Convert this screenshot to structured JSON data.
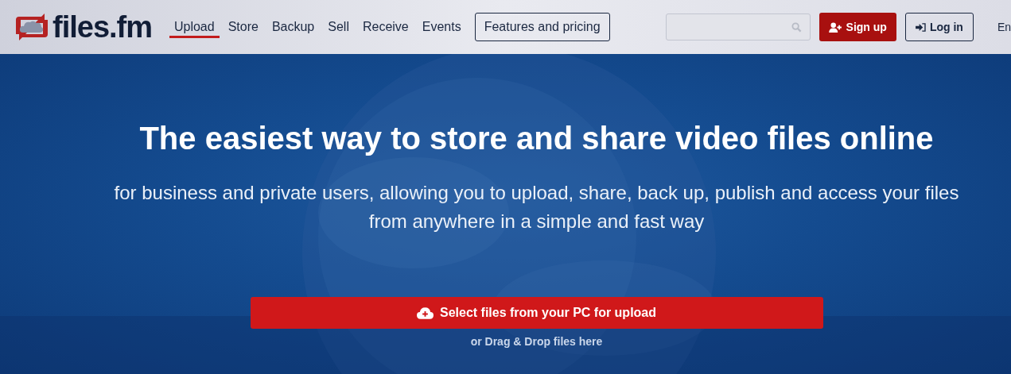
{
  "header": {
    "logo": "files.fm",
    "nav": [
      {
        "label": "Upload",
        "selected": true
      },
      {
        "label": "Store",
        "selected": false
      },
      {
        "label": "Backup",
        "selected": false
      },
      {
        "label": "Sell",
        "selected": false
      },
      {
        "label": "Receive",
        "selected": false
      },
      {
        "label": "Events",
        "selected": false
      }
    ],
    "features_button": "Features and pricing",
    "signup_button": "Sign up",
    "login_button": "Log in",
    "language": "En"
  },
  "hero": {
    "title": "The easiest way to store and share video files online",
    "subtitle": "for business and private users, allowing you to upload, share, back up, publish and access your files from anywhere in a simple and fast way",
    "upload_button": "Select files from your PC for upload",
    "drop_hint": "or Drag & Drop files here"
  }
}
